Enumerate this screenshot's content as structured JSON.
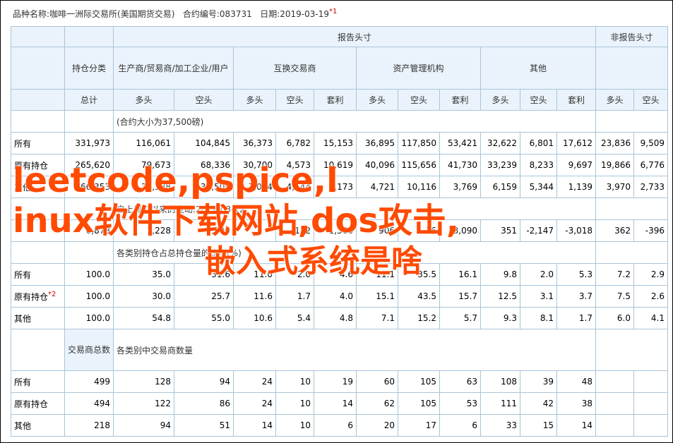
{
  "product_line": {
    "label": "品种名称:咖啡一洲际交易所(美国期货交易)",
    "contract_code": "合约编号:083731",
    "date": "日期:2019-03-19",
    "note_mark": "*1"
  },
  "headers": {
    "reportable": "报告头寸",
    "nonreportable": "非报告头寸",
    "position_class": "持仓分类",
    "producer": "生产商/贸易商/加工企业/用户",
    "swap": "互换交易商",
    "managed": "资产管理机构",
    "other": "其他",
    "total": "总计",
    "long": "多头",
    "short": "空头",
    "spread": "套利"
  },
  "section_notes": {
    "contract_size": "(合约大小为37,500磅)",
    "changes": "自上周二以来的变动:2019-03-12",
    "percent": "各类别持仓占总持仓量的比例(%)",
    "traders_label": "交易商总数",
    "traders": "各类别中交易商数量"
  },
  "positions": [
    {
      "label": "所有",
      "total": "331,973",
      "p_long": "116,061",
      "p_short": "104,845",
      "s_long": "36,373",
      "s_short": "6,782",
      "s_spread": "15,153",
      "m_long": "36,895",
      "m_short": "117,850",
      "m_spread": "53,421",
      "o_long": "32,622",
      "o_short": "6,801",
      "o_spread": "17,612",
      "n_long": "23,836",
      "n_short": "9,509"
    },
    {
      "label": "原有持仓",
      "total": "265,620",
      "p_long": "79,673",
      "p_short": "68,336",
      "s_long": "30,700",
      "s_short": "4,573",
      "s_spread": "10,619",
      "m_long": "40,096",
      "m_short": "115,656",
      "m_spread": "41,730",
      "o_long": "33,239",
      "o_short": "8,233",
      "o_spread": "9,697",
      "n_long": "19,866",
      "n_short": "6,776"
    },
    {
      "label": "其他",
      "total": "66,353",
      "p_long": "36,388",
      "p_short": "36,509",
      "s_long": "7,004",
      "s_short": "4,544",
      "s_spread": "3,173",
      "m_long": "4,721",
      "m_short": "10,116",
      "m_spread": "3,769",
      "o_long": "6,159",
      "o_short": "5,344",
      "o_spread": "1,139",
      "n_long": "3,970",
      "n_short": "2,733"
    }
  ],
  "changes_row": {
    "label": "",
    "total": "6,878",
    "p_long": "1,228",
    "p_short": "5,890",
    "s_long": "",
    "s_short": "132",
    "s_spread": "1,366",
    "m_long": "906",
    "m_short": "16",
    "m_spread": "3,090",
    "o_long": "351",
    "o_short": "-2,147",
    "o_spread": "-3,018",
    "n_long": "362",
    "n_short": "-396"
  },
  "percents": [
    {
      "label": "所有",
      "total": "100.0",
      "p_long": "35.0",
      "p_short": "31.6",
      "s_long": "11.0",
      "s_short": "2.0",
      "s_spread": "4.6",
      "m_long": "11.1",
      "m_short": "35.5",
      "m_spread": "16.1",
      "o_long": "9.8",
      "o_short": "2.0",
      "o_spread": "5.3",
      "n_long": "7.2",
      "n_short": "2.9"
    },
    {
      "label": "原有持仓",
      "label_mark": "*2",
      "total": "100.0",
      "p_long": "30.0",
      "p_short": "25.7",
      "s_long": "11.6",
      "s_short": "1.7",
      "s_spread": "4.0",
      "m_long": "15.1",
      "m_short": "43.5",
      "m_spread": "15.7",
      "o_long": "12.5",
      "o_short": "3.1",
      "o_spread": "3.7",
      "n_long": "7.5",
      "n_short": "2.6"
    },
    {
      "label": "其他",
      "total": "100.0",
      "p_long": "54.8",
      "p_short": "55.0",
      "s_long": "10.6",
      "s_short": "5.4",
      "s_spread": "4.8",
      "m_long": "7.1",
      "m_short": "15.2",
      "m_spread": "5.7",
      "o_long": "9.3",
      "o_short": "8.1",
      "o_spread": "1.7",
      "n_long": "6.0",
      "n_short": "4.1"
    }
  ],
  "traders": [
    {
      "label": "所有",
      "total": "499",
      "p_long": "128",
      "p_short": "94",
      "s_long": "24",
      "s_short": "10",
      "s_spread": "19",
      "m_long": "60",
      "m_short": "105",
      "m_spread": "63",
      "o_long": "108",
      "o_short": "39",
      "o_spread": "48",
      "n_long": "",
      "n_short": ""
    },
    {
      "label": "原有持仓",
      "total": "494",
      "p_long": "122",
      "p_short": "86",
      "s_long": "24",
      "s_short": "10",
      "s_spread": "14",
      "m_long": "62",
      "m_short": "105",
      "m_spread": "53",
      "o_long": "111",
      "o_short": "42",
      "o_spread": "38",
      "n_long": "",
      "n_short": ""
    },
    {
      "label": "其他",
      "total": "218",
      "p_long": "94",
      "p_short": "51",
      "s_long": "14",
      "s_short": "10",
      "s_spread": "6",
      "m_long": "20",
      "m_short": "17",
      "m_spread": "6",
      "o_long": "33",
      "o_short": "15",
      "o_spread": "14",
      "n_long": "",
      "n_short": ""
    }
  ],
  "watermark": {
    "line1": "leetcode,pspice,l",
    "line2": "inux软件下载网站,dos攻击,",
    "line3": "嵌入式系统是啥"
  }
}
